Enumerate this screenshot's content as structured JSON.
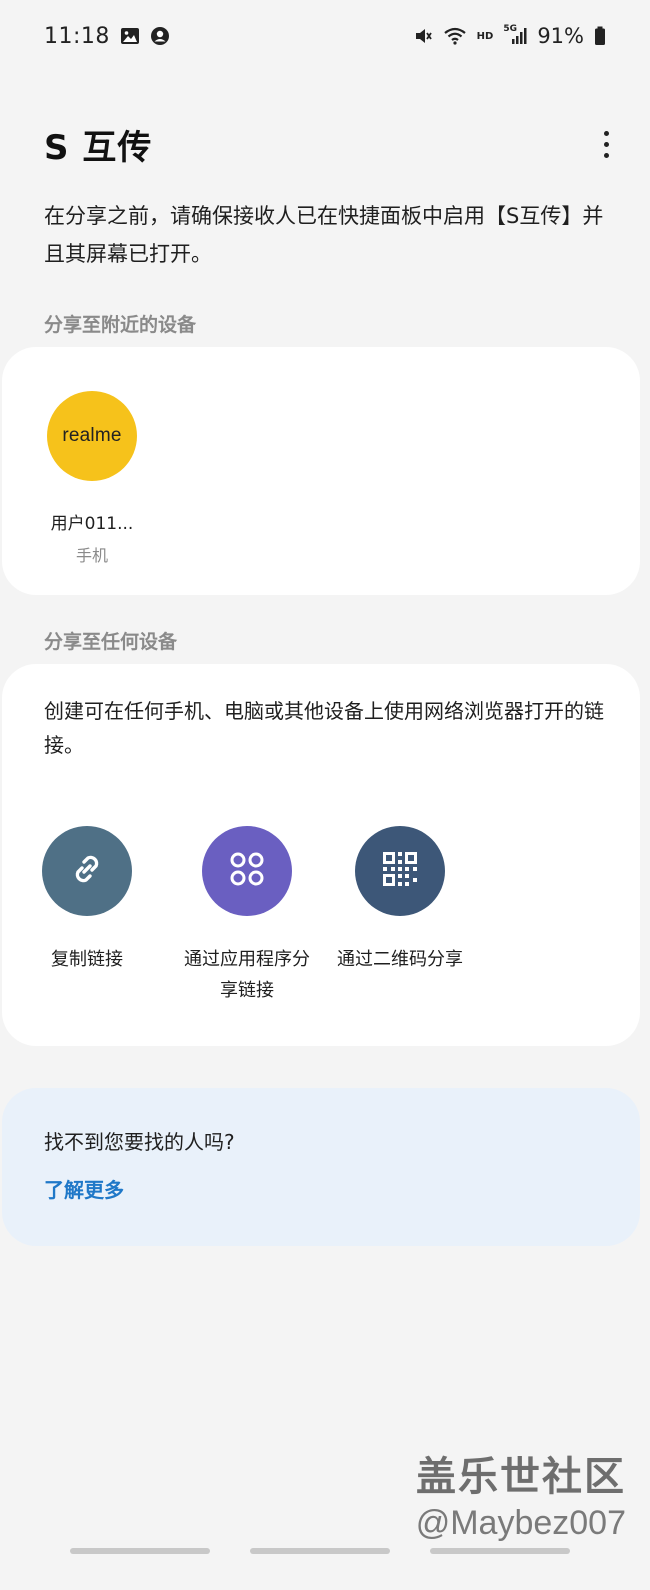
{
  "status_bar": {
    "time": "11:18",
    "battery": "91%",
    "hd_label": "HD",
    "network_label": "5G"
  },
  "header": {
    "title": "S 互传"
  },
  "intro": "在分享之前，请确保接收人已在快捷面板中启用【S互传】并且其屏幕已打开。",
  "nearby": {
    "label": "分享至附近的设备",
    "devices": [
      {
        "brand": "realme",
        "name": "用户011...",
        "type": "手机",
        "avatar_color": "#f6c21b"
      }
    ]
  },
  "any_device": {
    "label": "分享至任何设备",
    "description": "创建可在任何手机、电脑或其他设备上使用网络浏览器打开的链接。",
    "options": [
      {
        "label": "复制链接",
        "icon": "link-icon",
        "color": "#4f7086"
      },
      {
        "label": "通过应用程序分享链接",
        "icon": "apps-icon",
        "color": "#6a5fc1"
      },
      {
        "label": "通过二维码分享",
        "icon": "qr-code-icon",
        "color": "#3d5778"
      }
    ]
  },
  "help": {
    "question": "找不到您要找的人吗?",
    "link": "了解更多",
    "link_color": "#1f78c8"
  },
  "watermark": {
    "line1": "盖乐世社区",
    "line2": "@Maybez007"
  }
}
